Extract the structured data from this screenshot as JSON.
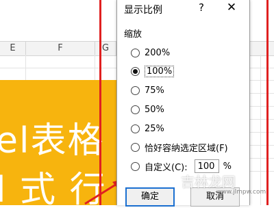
{
  "sheet": {
    "columns": [
      "E",
      "F",
      "G"
    ],
    "cell_text_line1": "el表格",
    "cell_text_line2": "l 式 行",
    "colors": {
      "fill": "#f7b40e",
      "annotation": "#e02020"
    }
  },
  "dialog": {
    "title": "显示比例",
    "help_label": "?",
    "close_label": "✕",
    "group_label": "缩放",
    "options": [
      {
        "label": "200%",
        "checked": false
      },
      {
        "label": "100%",
        "checked": true
      },
      {
        "label": "75%",
        "checked": false
      },
      {
        "label": "50%",
        "checked": false
      },
      {
        "label": "25%",
        "checked": false
      },
      {
        "label": "恰好容纳选定区域(F)",
        "checked": false
      },
      {
        "label": "自定义(C):",
        "checked": false
      }
    ],
    "custom_value": "100",
    "custom_unit": "%",
    "ok_label": "确定",
    "cancel_label": "取消",
    "accent": "#1a6fd0"
  },
  "watermark": {
    "text": "吉林龙网",
    "small": "www.jlmpw.com"
  }
}
